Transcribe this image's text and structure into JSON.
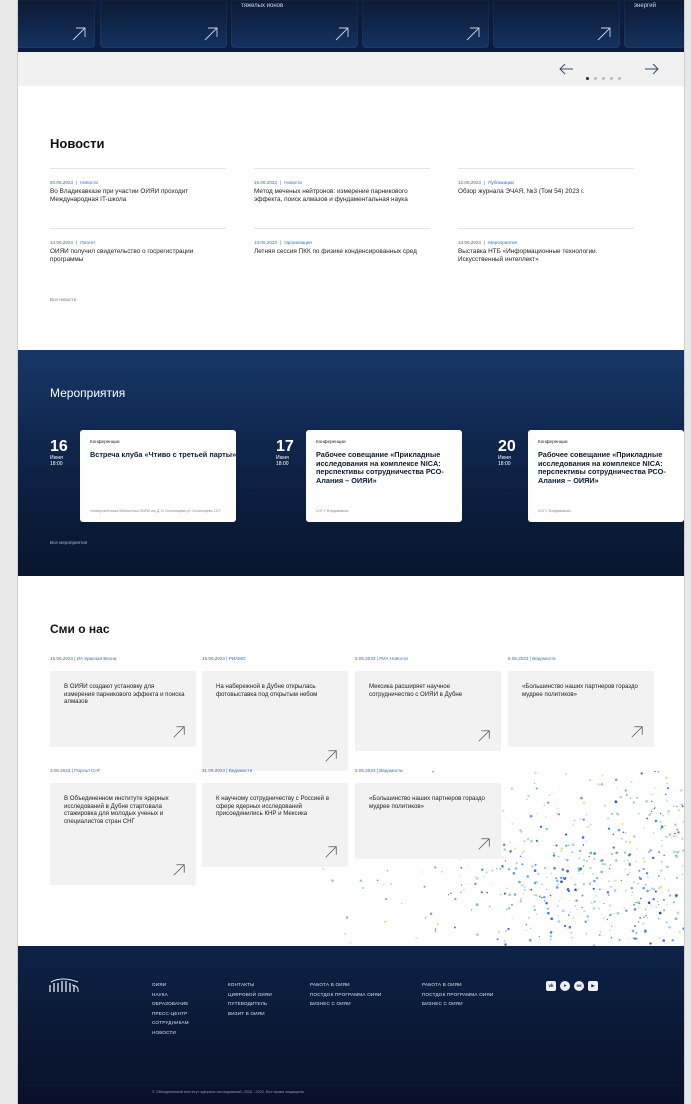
{
  "carousel": {
    "cards": [
      {
        "caption": ""
      },
      {
        "caption": ""
      },
      {
        "caption": "тяжелых ионов"
      },
      {
        "caption": ""
      },
      {
        "caption": ""
      },
      {
        "caption": "энергий"
      },
      {
        "caption": ""
      }
    ],
    "dots_total": 5,
    "active_dot": 0
  },
  "news": {
    "title": "Новости",
    "items": [
      {
        "date": "20.06.2023",
        "category": "Новости",
        "title": "Во Владикавказе при участии ОИЯИ проходит Международная IT-школа"
      },
      {
        "date": "15.06.2023",
        "category": "Новости",
        "title": "Метод меченых нейтронов: измерение парникового эффекта, поиск алмазов и фундаментальная наука"
      },
      {
        "date": "12.06.2023",
        "category": "Публикации",
        "title": "Обзор журнала ЭЧАЯ, №3 (Том 54) 2023 г."
      },
      {
        "date": "14.06.2023",
        "category": "Патент",
        "title": "ОИЯИ получил свидетельство о госрегистрации программы"
      },
      {
        "date": "13.06.2023",
        "category": "Организация",
        "title": "Летняя сессия ПКК по физике конденсированных сред"
      },
      {
        "date": "13.06.2023",
        "category": "Мероприятия",
        "title": "Выставка НТБ «Информационные технологии. Искусственный интеллект»"
      }
    ],
    "all_link": "Все новости"
  },
  "events": {
    "title": "Мероприятия",
    "items": [
      {
        "day": "16",
        "month": "Июня",
        "time": "18:00",
        "category": "Конференции",
        "title": "Встреча клуба «Чтиво с третьей парты»",
        "place": "Университетская библиотека ОИЯИ им Д. И. Блохинцева ул. Блохинцева 13/7"
      },
      {
        "day": "17",
        "month": "Июня",
        "time": "18:00",
        "category": "Конференции",
        "title": "Рабочее совещание «Прикладные исследования на комплексе NICA: перспективы сотрудничества РСО-Алания – ОИЯИ»",
        "place": "СОГУ, Владикавказ"
      },
      {
        "day": "20",
        "month": "Июня",
        "time": "18:00",
        "category": "Конференции",
        "title": "Рабочее совещание «Прикладные исследования на комплексе NICA: перспективы сотрудничества РСО-Алания – ОИЯИ»",
        "place": "СОГУ, Владикавказ"
      }
    ],
    "all_link": "Все мероприятия"
  },
  "media": {
    "title": "Сми о нас",
    "items": [
      {
        "date": "15.06.2023",
        "source": "ИА Красная Весна",
        "text": "В ОИЯИ создают установку для измерения парникового эффекта и поиска алмазов"
      },
      {
        "date": "15.06.2023",
        "source": "РИАМО",
        "text": "На набережной в Дубне открылась фотовыставка под открытым небом"
      },
      {
        "date": "5.06.2023",
        "source": "РИА Новости",
        "text": "Мексика расширяет научное сотрудничество с ОИЯИ в Дубне"
      },
      {
        "date": "5.06.2023",
        "source": "Ведомости",
        "text": "«Большинство наших партнеров гораздо мудрее политиков»"
      },
      {
        "date": "3.06.2023",
        "source": "Портал СНГ",
        "text": "В Объединенном институте ядерных исследований в Дубне стартовала стажировка для молодых ученых и специалистов стран СНГ"
      },
      {
        "date": "31.05.2023",
        "source": "Ведомости",
        "text": "К научному сотрудничеству с Россией в сфере ядерных исследований присоединились КНР и Мексика"
      },
      {
        "date": "5.06.2023",
        "source": "Ведомости",
        "text": "«Большинство наших партнеров гораздо мудрее политиков»"
      }
    ]
  },
  "footer": {
    "col1": [
      "ОИЯИ",
      "НАУКА",
      "ОБРАЗОВАНИЕ",
      "ПРЕСС-ЦЕНТР",
      "СОТРУДНИКАМ",
      "НОВОСТИ"
    ],
    "col2": [
      "КОНТАКТЫ",
      "ЦИФРОВОЙ ОИЯИ",
      "ПУТЕВОДИТЕЛЬ",
      "ВИЗИТ В ОИЯИ"
    ],
    "col3": [
      "РАБОТА В ОИЯИ",
      "ПОСТДОК ПРОГРАММА ОИЯИ",
      "БИЗНЕС С ОИЯИ"
    ],
    "col4": [
      "РАБОТА В ОИЯИ",
      "ПОСТДОК ПРОГРАММА ОИЯИ",
      "БИЗНЕС С ОИЯИ"
    ],
    "social": [
      "vk-icon",
      "telegram-icon",
      "odnoklassniki-icon",
      "youtube-icon"
    ],
    "copyright": "© Объединенный институт ядерных исследований, 2016 - 2023. Все права защищены"
  },
  "colors": {
    "navy": "#0d2144",
    "accent_blue": "#2a6fd0",
    "card_grey": "#f2f2f2"
  }
}
